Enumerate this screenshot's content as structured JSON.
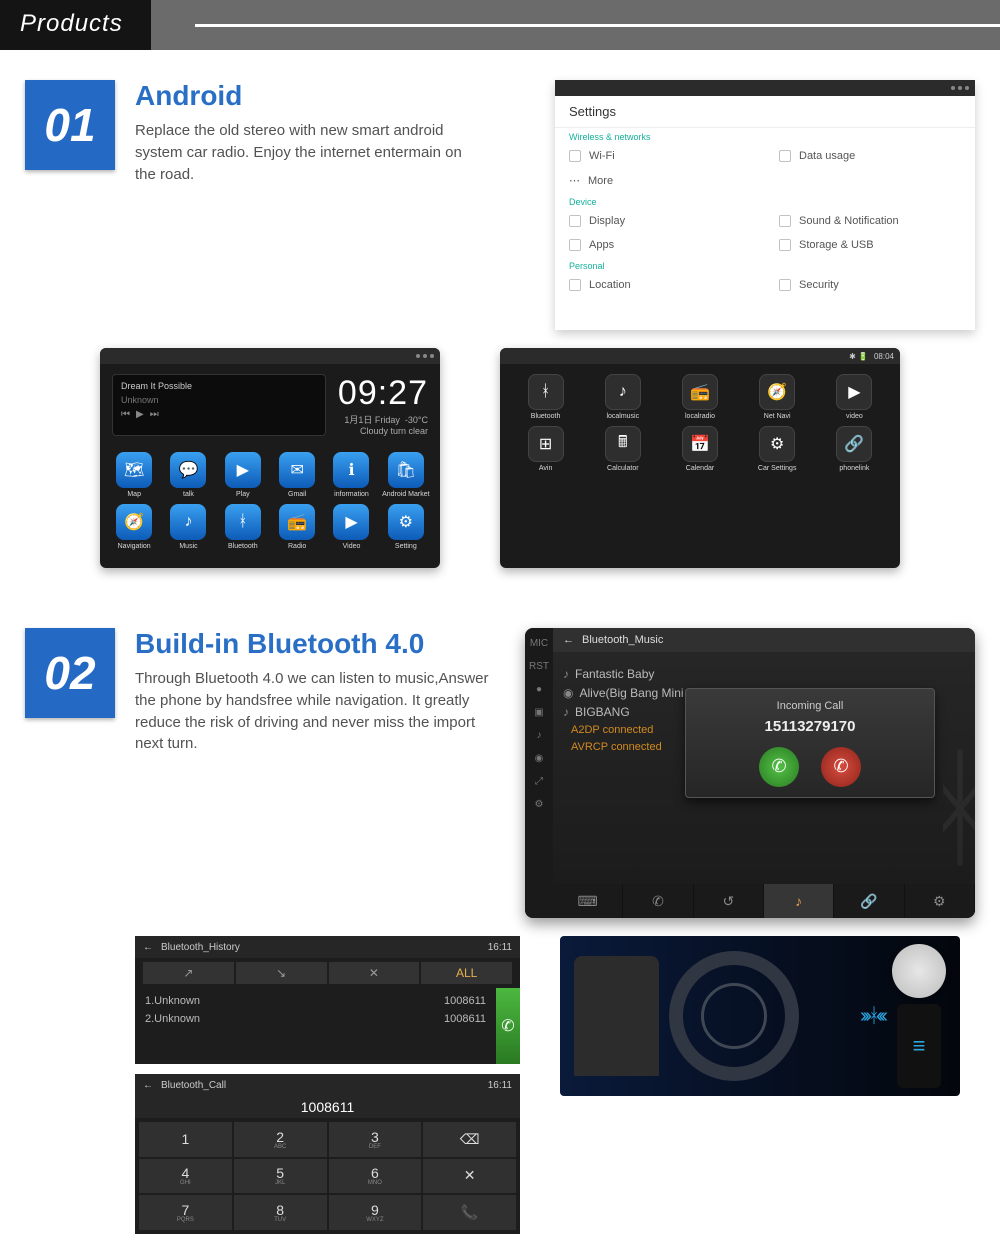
{
  "banner": {
    "title": "Products"
  },
  "section1": {
    "num": "01",
    "title": "Android",
    "desc": "Replace the old stereo with new smart android system car radio. Enjoy the internet entermain on the road."
  },
  "settings": {
    "title": "Settings",
    "groups": {
      "wireless": "Wireless & networks",
      "device": "Device",
      "personal": "Personal"
    },
    "items": {
      "wifi": "Wi-Fi",
      "data": "Data usage",
      "more": "More",
      "display": "Display",
      "sound": "Sound & Notification",
      "apps": "Apps",
      "storage": "Storage & USB",
      "location": "Location",
      "security": "Security"
    }
  },
  "home1": {
    "np_title": "Dream It Possible",
    "np_sub": "Unknown",
    "time": "09:27",
    "date": "1月1日 Friday",
    "weather": "Cloudy turn clear",
    "temp": "-30°C",
    "row1": [
      "Map",
      "talk",
      "Play",
      "Gmail",
      "information",
      "Android Market"
    ],
    "row2": [
      "Navigation",
      "Music",
      "Bluetooth",
      "Radio",
      "Video",
      "Setting"
    ]
  },
  "home2": {
    "time": "08:04",
    "row1": [
      "Bluetooth",
      "localmusic",
      "localradio",
      "Net Navi",
      "video"
    ],
    "row2": [
      "Avin",
      "Calculator",
      "Calendar",
      "Car Settings",
      "phonelink"
    ]
  },
  "section2": {
    "num": "02",
    "title": "Build-in Bluetooth 4.0",
    "desc": "Through Bluetooth 4.0 we can listen to music,Answer the phone by handsfree while navigation. It greatly reduce the risk of driving and never miss the import next turn."
  },
  "btmusic": {
    "hdr": "Bluetooth_Music",
    "songs": {
      "s1": "Fantastic Baby",
      "s2": "Alive(Big Bang Mini Album Vol...",
      "s3": "BIGBANG",
      "l1": "A2DP connected",
      "l2": "AVRCP connected"
    },
    "call": {
      "label": "Incoming Call",
      "number": "15113279170"
    },
    "siderail": [
      "MIC",
      "RST",
      "●",
      "▣",
      "♪",
      "◉",
      "⤢",
      "⚙"
    ]
  },
  "bthist": {
    "hdr": "Bluetooth_History",
    "time": "16:11",
    "tabs": [
      "↗",
      "↘",
      "✕",
      "ALL"
    ],
    "rows": [
      {
        "name": "1.Unknown",
        "num": "1008611"
      },
      {
        "name": "2.Unknown",
        "num": "1008611"
      }
    ]
  },
  "btcall": {
    "hdr": "Bluetooth_Call",
    "time": "16:11",
    "number": "1008611",
    "keys": [
      {
        "n": "1",
        "s": ""
      },
      {
        "n": "2",
        "s": "ABC"
      },
      {
        "n": "3",
        "s": "DEF"
      },
      {
        "n": "⌫",
        "s": ""
      },
      {
        "n": "4",
        "s": "GHI"
      },
      {
        "n": "5",
        "s": "JKL"
      },
      {
        "n": "6",
        "s": "MNO"
      },
      {
        "n": "✕",
        "s": ""
      },
      {
        "n": "7",
        "s": "PQRS"
      },
      {
        "n": "8",
        "s": "TUV"
      },
      {
        "n": "9",
        "s": "WXYZ"
      },
      {
        "n": "📞",
        "s": ""
      }
    ]
  }
}
